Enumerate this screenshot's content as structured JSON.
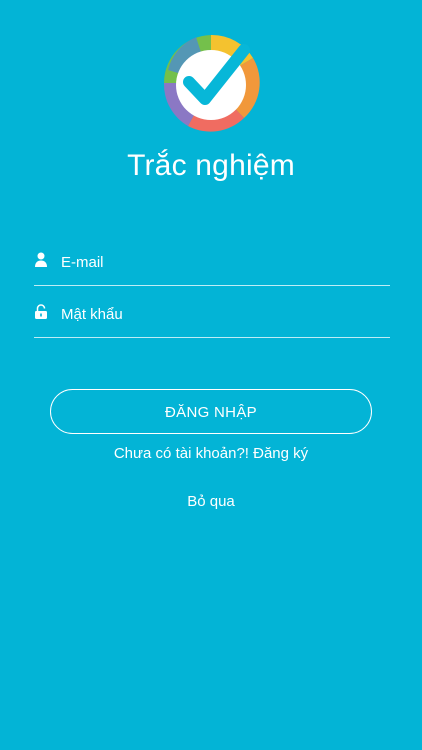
{
  "app": {
    "title": "Trắc nghiệm",
    "logo_icon": "quiz-check-logo",
    "background_color": "#03b4d6"
  },
  "form": {
    "email": {
      "icon": "user-icon",
      "placeholder": "E-mail",
      "value": ""
    },
    "password": {
      "icon": "lock-icon",
      "placeholder": "Mật khẩu",
      "value": ""
    },
    "login_button": "ĐĂNG NHẬP",
    "register_link": "Chưa có tài khoản?! Đăng ký",
    "skip_link": "Bỏ qua"
  },
  "logo_colors": {
    "green": "#74c04b",
    "yellow": "#f4c22f",
    "purple": "#8b78c4",
    "coral": "#f06c61",
    "orange": "#f1983b",
    "blue": "#4a8ad8",
    "white": "#ffffff",
    "check": "#07b7d8"
  }
}
